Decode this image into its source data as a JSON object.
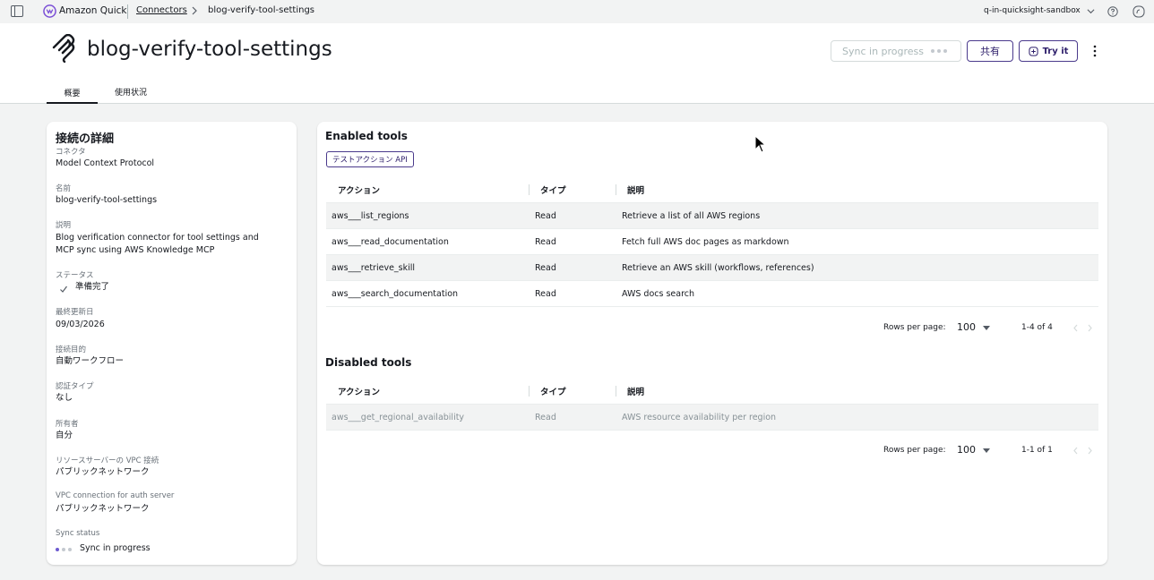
{
  "topbar": {
    "brand": "Amazon Quick",
    "breadcrumb_link": "Connectors",
    "breadcrumb_current": "blog-verify-tool-settings",
    "account": "q-in-quicksight-sandbox"
  },
  "header": {
    "title": "blog-verify-tool-settings",
    "sync_button": "Sync in progress",
    "share_button": "共有",
    "try_button": "Try it",
    "tabs": [
      {
        "label": "概要",
        "active": true
      },
      {
        "label": "使用状況",
        "active": false
      }
    ]
  },
  "details": {
    "title": "接続の詳細",
    "fields": [
      {
        "label": "コネクタ",
        "value": "Model Context Protocol"
      },
      {
        "label": "名前",
        "value": "blog-verify-tool-settings"
      },
      {
        "label": "説明",
        "value": "Blog verification connector for tool settings and MCP sync using AWS Knowledge MCP"
      },
      {
        "label": "ステータス",
        "value": "準備完了"
      },
      {
        "label": "最終更新日",
        "value": "09/03/2026"
      },
      {
        "label": "接続目的",
        "value": "自動ワークフロー"
      },
      {
        "label": "認証タイプ",
        "value": "なし"
      },
      {
        "label": "所有者",
        "value": "自分"
      },
      {
        "label": "リソースサーバーの VPC 接続",
        "value": "パブリックネットワーク"
      },
      {
        "label": "VPC connection for auth server",
        "value": "パブリックネットワーク"
      },
      {
        "label": "Sync status",
        "value": "Sync in progress"
      }
    ]
  },
  "enabled": {
    "title": "Enabled tools",
    "chip": "テストアクション API",
    "columns": [
      "アクション",
      "タイプ",
      "説明"
    ],
    "rows": [
      {
        "action": "aws___list_regions",
        "type": "Read",
        "desc": "Retrieve a list of all AWS regions"
      },
      {
        "action": "aws___read_documentation",
        "type": "Read",
        "desc": "Fetch full AWS doc pages as markdown"
      },
      {
        "action": "aws___retrieve_skill",
        "type": "Read",
        "desc": "Retrieve an AWS skill (workflows, references)"
      },
      {
        "action": "aws___search_documentation",
        "type": "Read",
        "desc": "AWS docs search"
      }
    ],
    "pager": {
      "label": "Rows per page:",
      "value": "100",
      "range": "1-4 of 4"
    }
  },
  "disabled": {
    "title": "Disabled tools",
    "columns": [
      "アクション",
      "タイプ",
      "説明"
    ],
    "rows": [
      {
        "action": "aws___get_regional_availability",
        "type": "Read",
        "desc": "AWS resource availability per region"
      }
    ],
    "pager": {
      "label": "Rows per page:",
      "value": "100",
      "range": "1-1 of 1"
    }
  },
  "colors": {
    "accent": "#4a3a8c",
    "background": "#f2f3f3"
  }
}
